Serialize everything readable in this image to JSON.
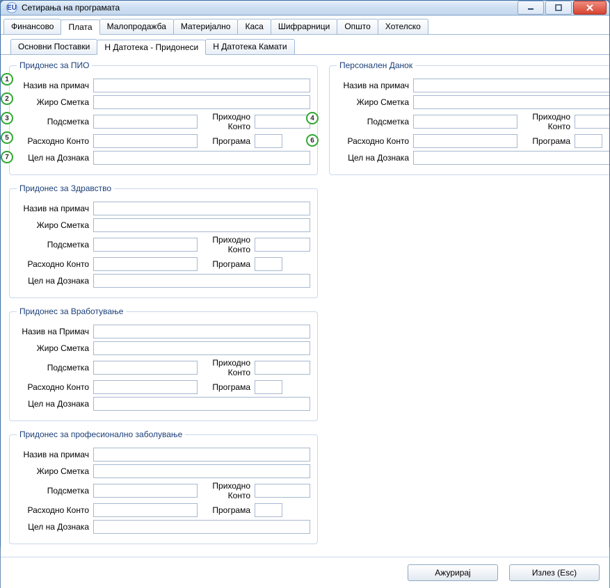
{
  "window": {
    "title": "Сетирања на програмата",
    "app_icon_label": "EU"
  },
  "main_tabs": [
    "Финансово",
    "Плата",
    "Малопродажба",
    "Материјално",
    "Каса",
    "Шифрарници",
    "Општо",
    "Хотелско"
  ],
  "main_active": 1,
  "sub_tabs": [
    "Основни Поставки",
    "Н Датотека - Придонеси",
    "Н Датотека Камати"
  ],
  "sub_active": 1,
  "labels": {
    "naziv": "Назив на примач",
    "naziv_primac": "Назив на Примач",
    "ziro": "Жиро Сметка",
    "podsmetka": "Подсметка",
    "prihodno": "Приходно Конто",
    "rashodno": "Расходно Конто",
    "programa": "Програма",
    "cel": "Цел на Дознака"
  },
  "groups": {
    "pio": "Придонес за ПИО",
    "personalen": "Персонален Данок",
    "zdravstvo": "Придонес за Здравство",
    "vrabotuvanje": "Придонес за Вработување",
    "profesionalno": "Придонес за професионално заболување"
  },
  "buttons": {
    "update": "Ажурирај",
    "exit": "Излез (Esc)"
  },
  "markers": [
    "1",
    "2",
    "3",
    "4",
    "5",
    "6",
    "7"
  ]
}
